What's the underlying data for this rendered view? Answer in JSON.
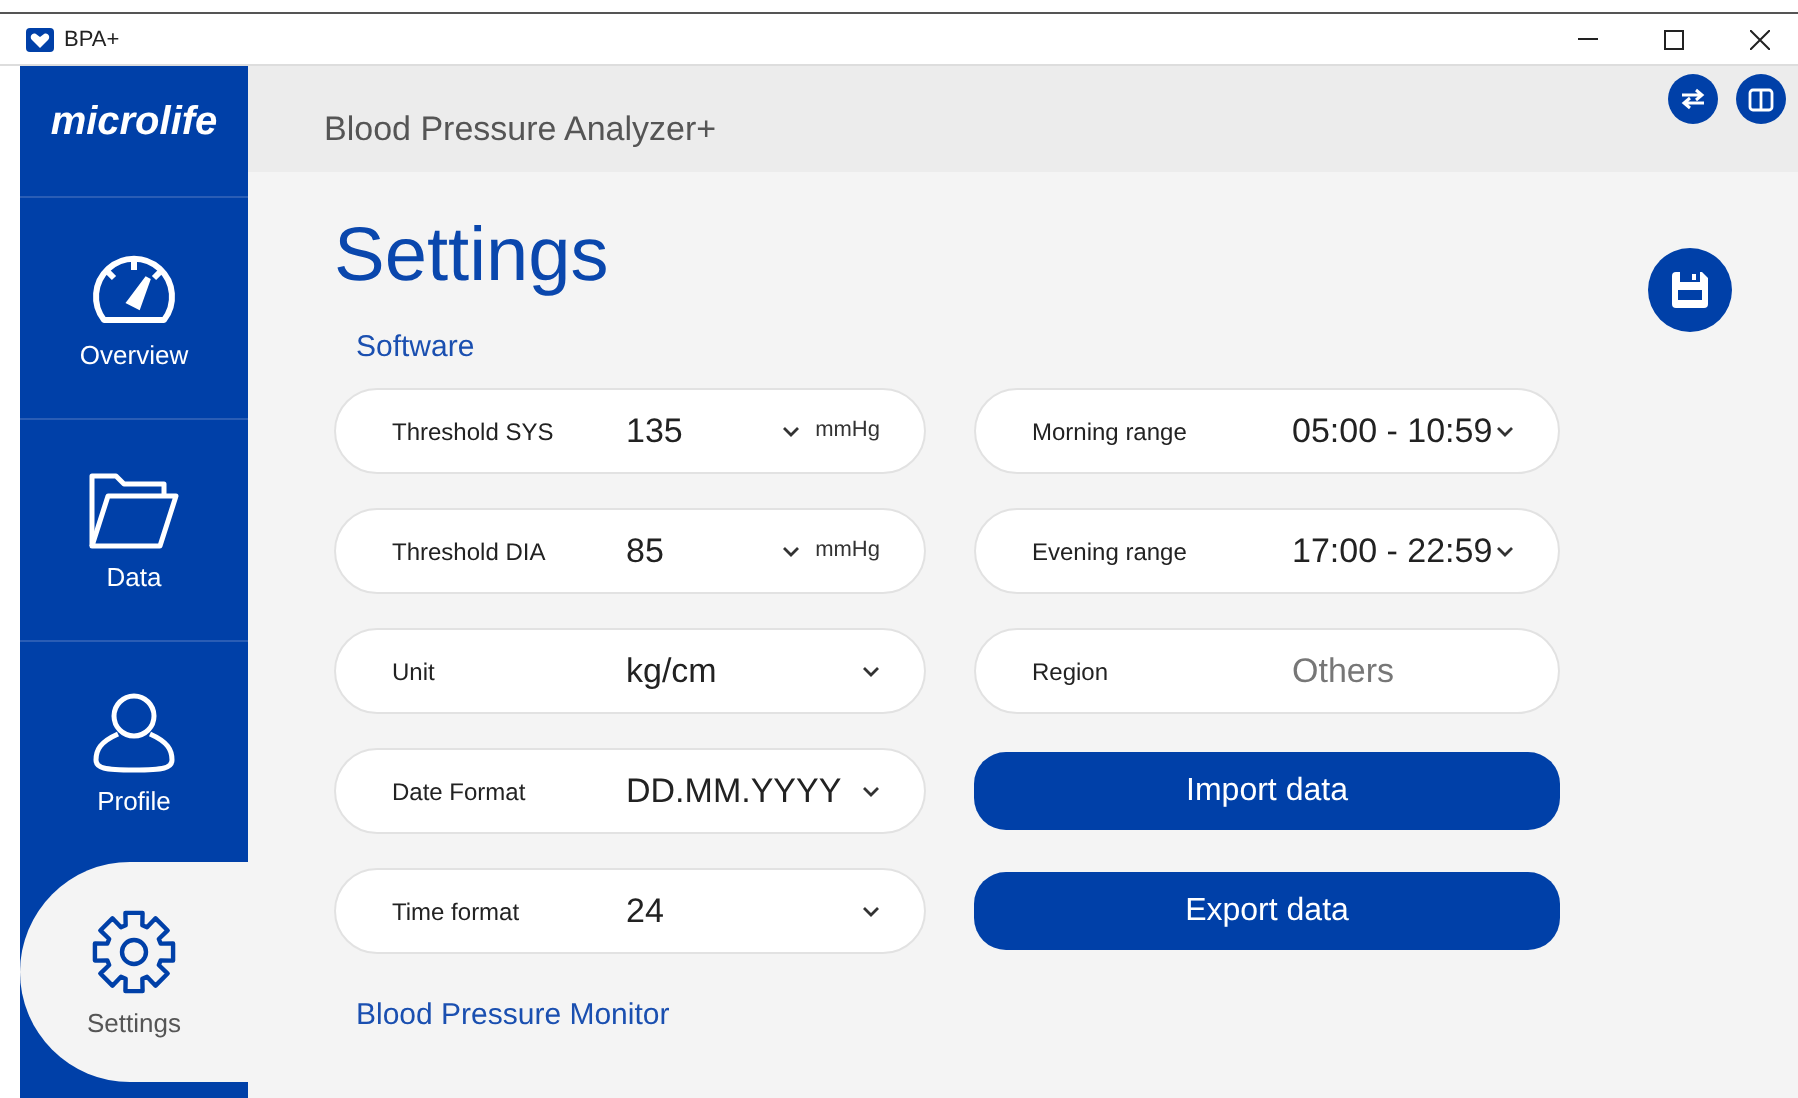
{
  "window": {
    "title": "BPA+"
  },
  "sidebar": {
    "logo": "microlife",
    "items": [
      {
        "label": "Overview",
        "kind": "gauge",
        "selected": false
      },
      {
        "label": "Data",
        "kind": "folder",
        "selected": false
      },
      {
        "label": "Profile",
        "kind": "person",
        "selected": false
      },
      {
        "label": "Settings",
        "kind": "gear",
        "selected": true
      }
    ]
  },
  "header": {
    "title": "Blood Pressure Analyzer+"
  },
  "page": {
    "title": "Settings",
    "section": "Software",
    "left": [
      {
        "kind": "dropdown",
        "label": "Threshold SYS",
        "value": "135",
        "unit": "mmHg"
      },
      {
        "kind": "dropdown",
        "label": "Threshold DIA",
        "value": "85",
        "unit": "mmHg"
      },
      {
        "kind": "dropdown",
        "label": "Unit",
        "value": "kg/cm"
      },
      {
        "kind": "dropdown",
        "label": "Date Format",
        "value": "DD.MM.YYYY"
      },
      {
        "kind": "dropdown",
        "label": "Time format",
        "value": "24"
      }
    ],
    "right": [
      {
        "kind": "dropdown",
        "label": "Morning range",
        "value": "05:00 - 10:59"
      },
      {
        "kind": "dropdown",
        "label": "Evening range",
        "value": "17:00 - 22:59"
      },
      {
        "kind": "text",
        "label": "Region",
        "placeholder": "Others"
      },
      {
        "kind": "button",
        "label": "Import data"
      },
      {
        "kind": "button",
        "label": "Export data"
      }
    ],
    "section_2": "Blood Pressure Monitor"
  }
}
